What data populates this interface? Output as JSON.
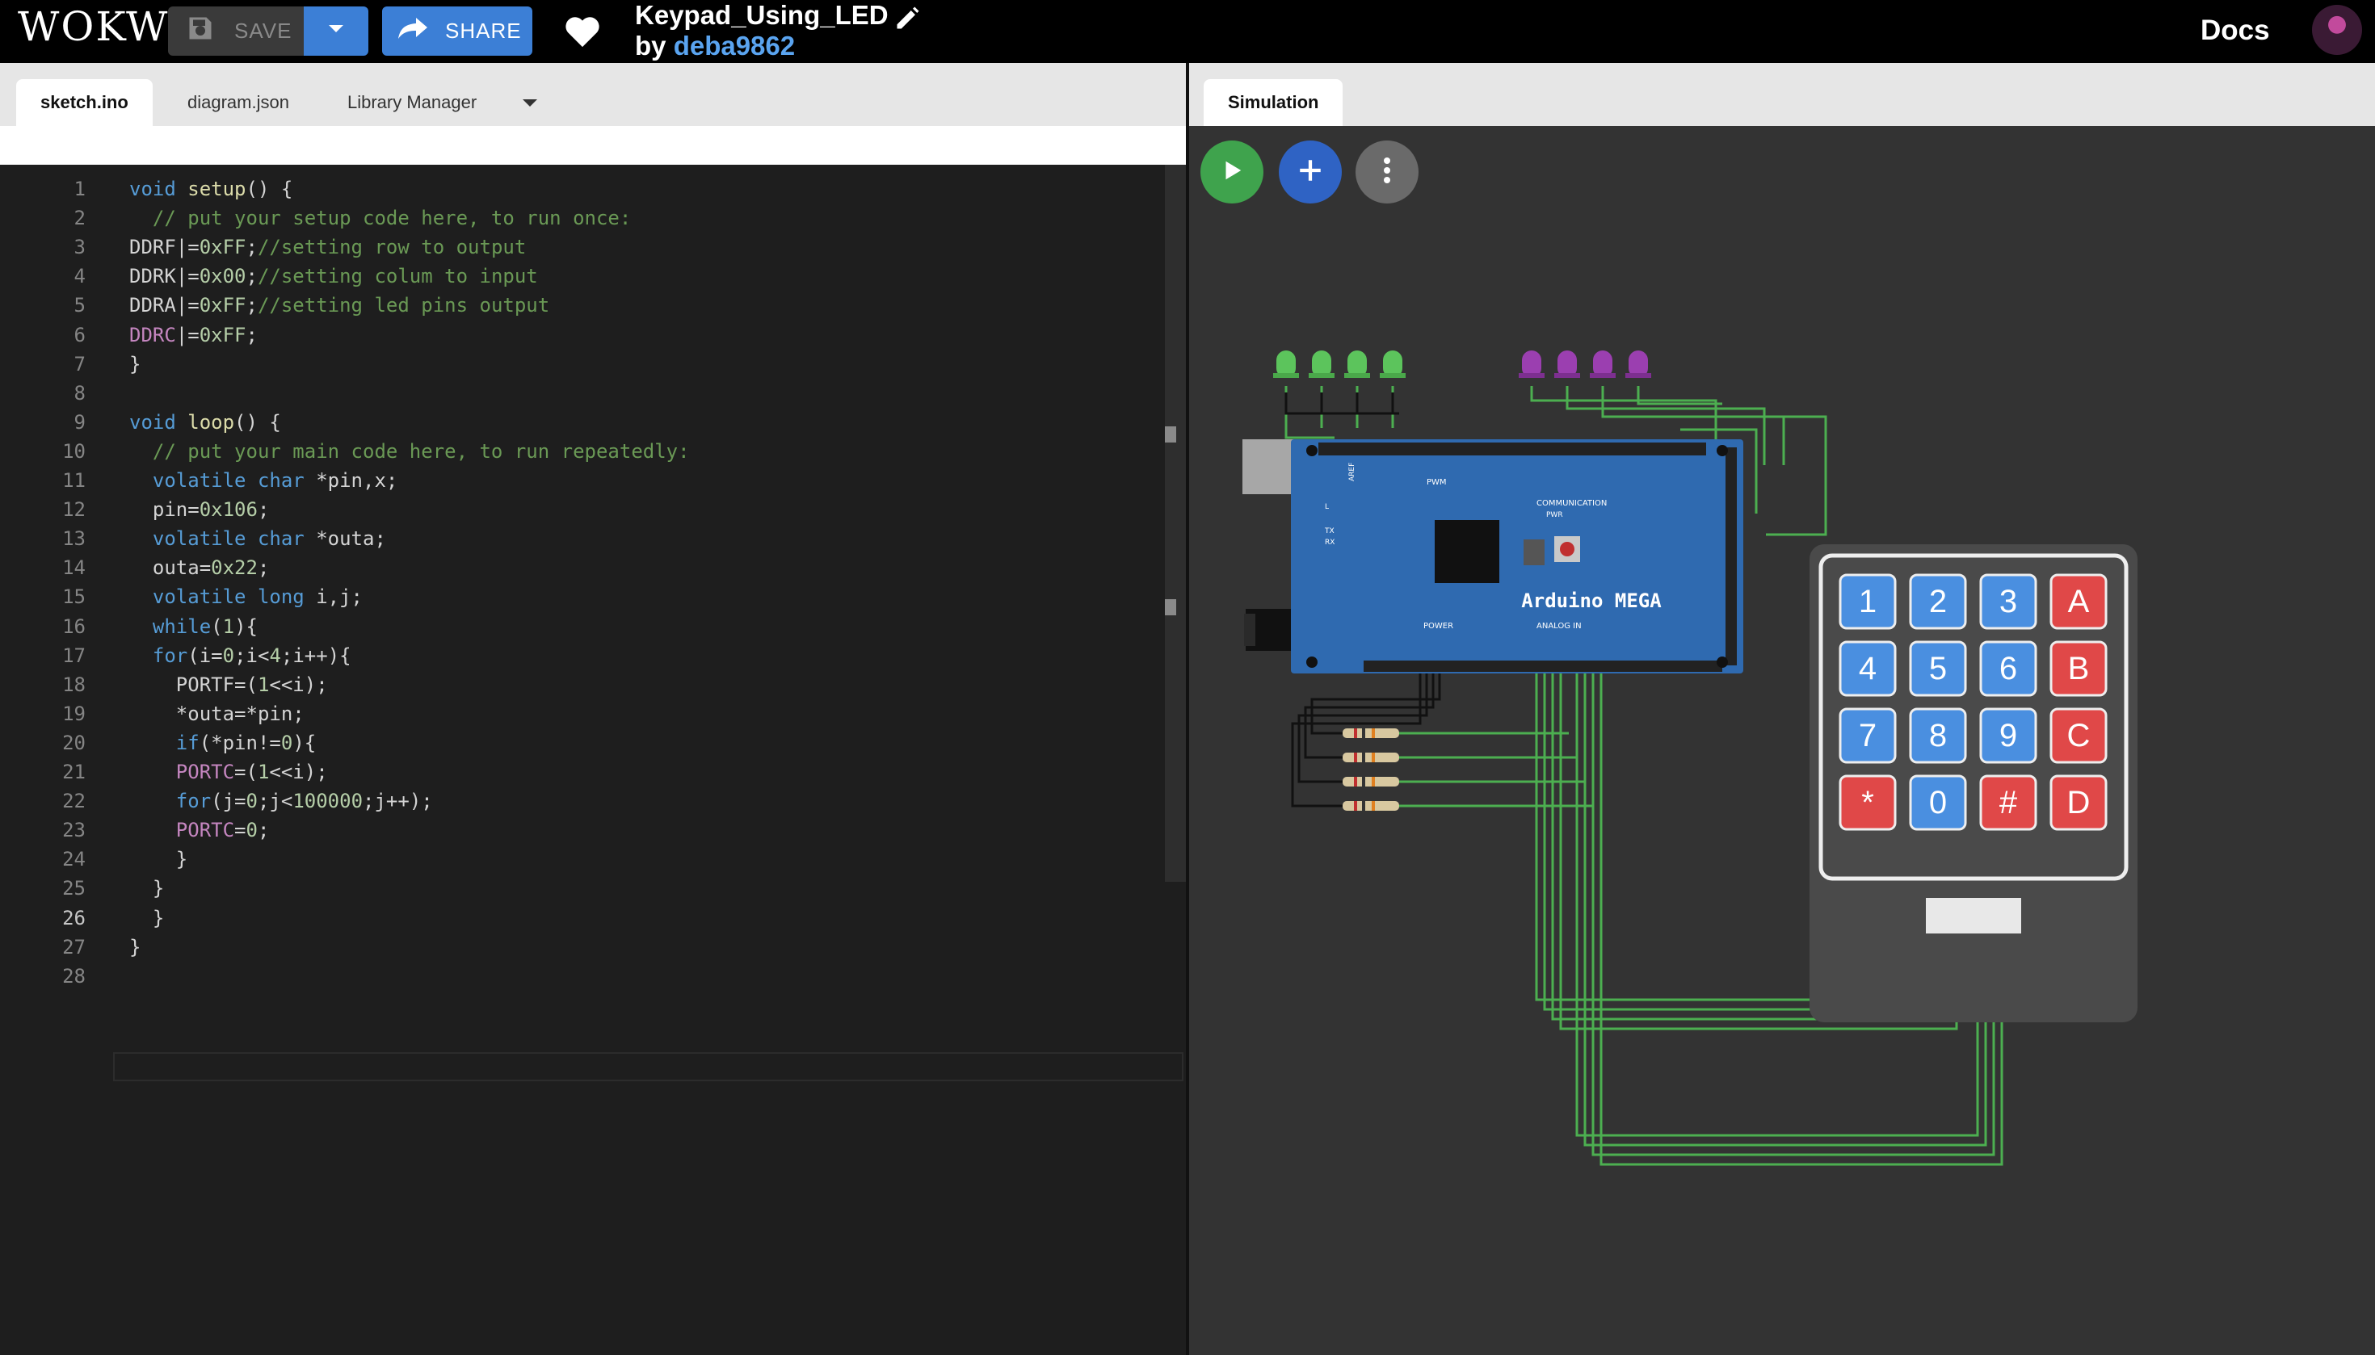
{
  "app": {
    "logo": "WOKWI"
  },
  "toolbar": {
    "save_label": "SAVE",
    "share_label": "SHARE"
  },
  "project": {
    "title": "Keypad_Using_LED",
    "by_prefix": "by",
    "author": "deba9862"
  },
  "nav": {
    "docs_label": "Docs"
  },
  "editor": {
    "tabs": [
      "sketch.ino",
      "diagram.json",
      "Library Manager"
    ],
    "active_tab": "sketch.ino",
    "line_numbers": [
      "1",
      "2",
      "3",
      "4",
      "5",
      "6",
      "7",
      "8",
      "9",
      "10",
      "11",
      "12",
      "13",
      "14",
      "15",
      "16",
      "17",
      "18",
      "19",
      "20",
      "21",
      "22",
      "23",
      "24",
      "25",
      "26",
      "27",
      "28"
    ],
    "code_lines": [
      "void setup() {",
      "  // put your setup code here, to run once:",
      "DDRF|=0xFF;//setting row to output",
      "DDRK|=0x00;//setting colum to input",
      "DDRA|=0xFF;//setting led pins output",
      "DDRC|=0xFF;",
      "}",
      "",
      "void loop() {",
      "  // put your main code here, to run repeatedly:",
      "  volatile char *pin,x;",
      "  pin=0x106;",
      "  volatile char *outa;",
      "  outa=0x22;",
      "  volatile long i,j;",
      "  while(1){",
      "  for(i=0;i<4;i++){",
      "    PORTF=(1<<i);",
      "    *outa=*pin;",
      "    if(*pin!=0){",
      "    PORTC=(1<<i);",
      "    for(j=0;j<100000;j++);",
      "    PORTC=0;",
      "    }",
      "  }",
      "  }",
      "}",
      ""
    ],
    "current_line": 26
  },
  "simulation": {
    "tab_label": "Simulation",
    "board_label": "Arduino MEGA",
    "board_sub": {
      "pwm": "PWM",
      "communication": "COMMUNICATION",
      "power": "POWER",
      "analog_in": "ANALOG IN",
      "pwr": "PWR",
      "tx": "TX",
      "rx": "RX",
      "l": "L",
      "aref": "AREF"
    },
    "keypad_keys": [
      "1",
      "2",
      "3",
      "A",
      "4",
      "5",
      "6",
      "B",
      "7",
      "8",
      "9",
      "C",
      "*",
      "0",
      "#",
      "D"
    ],
    "led_colors": {
      "green": "#5cc45c",
      "purple": "#9b3fb0"
    },
    "wire_color": "#4caf50"
  },
  "colors": {
    "accent": "#3c7fd6",
    "run": "#3fa34d",
    "board": "#2f6ab0",
    "key_blue": "#4a8fe0",
    "key_red": "#e04848"
  }
}
